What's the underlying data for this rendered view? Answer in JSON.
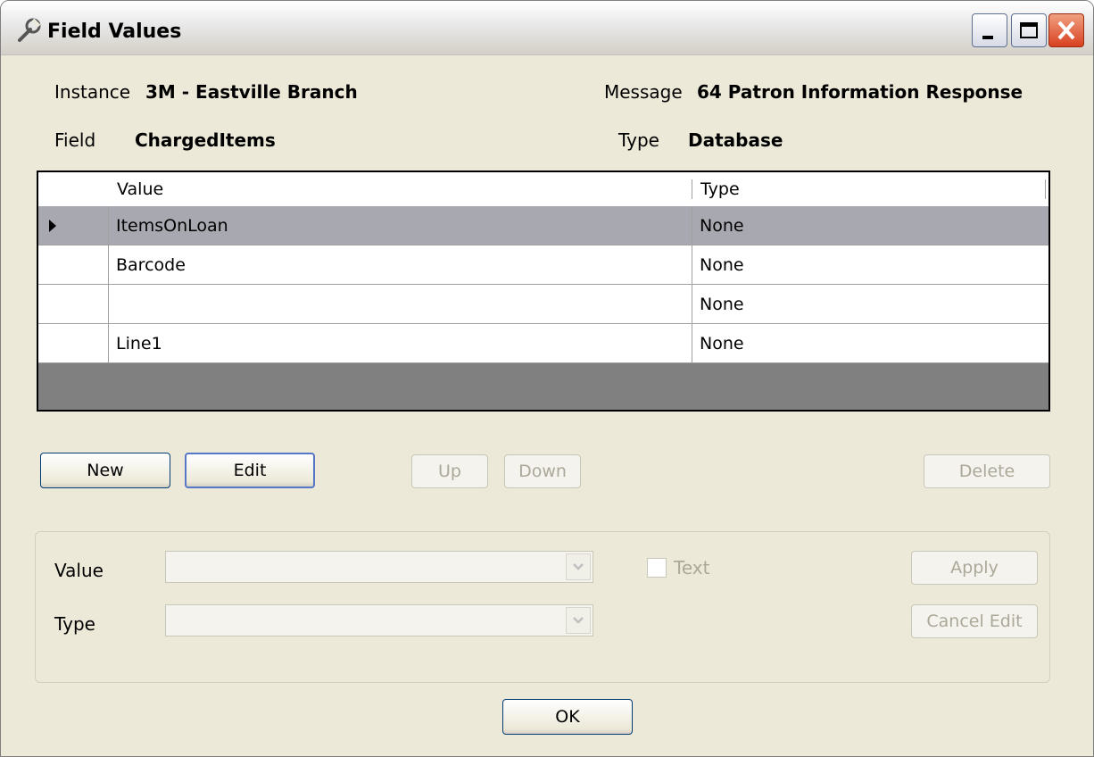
{
  "window": {
    "title": "Field Values"
  },
  "info": {
    "instance_label": "Instance",
    "instance_value": "3M - Eastville Branch",
    "message_label": "Message",
    "message_value": "64 Patron Information Response",
    "field_label": "Field",
    "field_value": "ChargedItems",
    "type_label": "Type",
    "type_value": "Database"
  },
  "grid": {
    "columns": [
      "Value",
      "Type"
    ],
    "rows": [
      {
        "value": "ItemsOnLoan",
        "type": "None",
        "selected": true
      },
      {
        "value": "Barcode",
        "type": "None",
        "selected": false
      },
      {
        "value": "",
        "type": "None",
        "selected": false
      },
      {
        "value": "Line1",
        "type": "None",
        "selected": false
      }
    ]
  },
  "buttons": {
    "new": "New",
    "edit": "Edit",
    "up": "Up",
    "down": "Down",
    "delete": "Delete",
    "apply": "Apply",
    "cancel_edit": "Cancel Edit",
    "ok": "OK"
  },
  "editor": {
    "value_label": "Value",
    "type_label": "Type",
    "value_selected": "",
    "type_selected": "",
    "text_checkbox_label": "Text",
    "text_checked": false
  }
}
